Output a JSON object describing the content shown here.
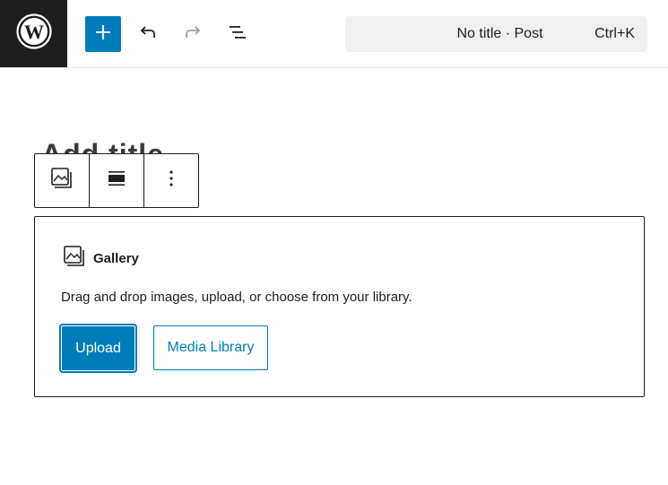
{
  "header": {
    "logo_icon": "wordpress-logo-icon",
    "inserter_icon": "plus-icon",
    "undo_icon": "undo-icon",
    "redo_icon": "redo-icon",
    "list_view_icon": "list-view-icon",
    "command": {
      "title": "No title · Post",
      "shortcut": "Ctrl+K"
    }
  },
  "canvas": {
    "title_placeholder": "Add title"
  },
  "block_toolbar": {
    "items": [
      {
        "icon": "gallery-icon"
      },
      {
        "icon": "align-wide-icon"
      },
      {
        "icon": "more-vertical-icon"
      }
    ]
  },
  "gallery_block": {
    "label": "Gallery",
    "label_icon": "gallery-icon",
    "instructions": "Drag and drop images, upload, or choose from your library.",
    "upload_label": "Upload",
    "media_library_label": "Media Library"
  },
  "colors": {
    "accent": "#007cba",
    "dark": "#1e1e1e",
    "command_bg": "#f0f0f0"
  }
}
